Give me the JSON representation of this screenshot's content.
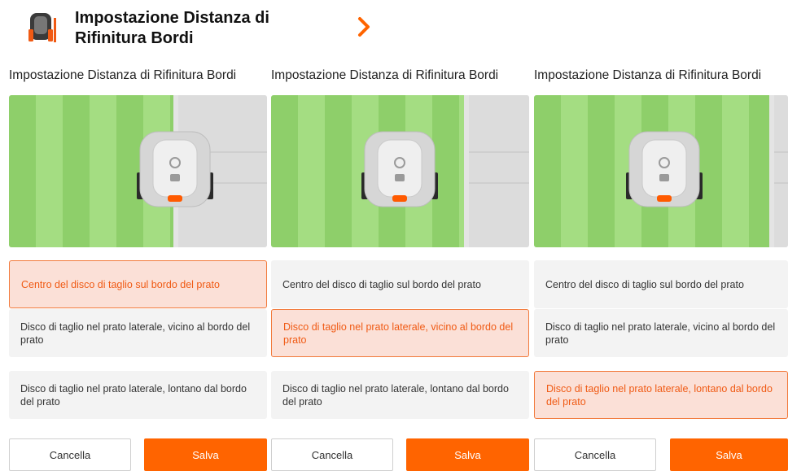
{
  "header": {
    "title": "Impostazione Distanza di Rifinitura Bordi",
    "icon": "mower-icon",
    "chevron_icon": "chevron-right-icon",
    "accent": "#ff6400"
  },
  "panels": [
    {
      "title": "Impostazione Distanza di Rifinitura Bordi",
      "selected_index": 0,
      "options": [
        "Centro del disco di taglio sul bordo del prato",
        "Disco di taglio nel prato laterale, vicino al bordo del prato",
        "Disco di taglio nel prato laterale, lontano dal bordo del prato"
      ],
      "cancel_label": "Cancella",
      "save_label": "Salva"
    },
    {
      "title": "Impostazione Distanza di Rifinitura Bordi",
      "selected_index": 1,
      "options": [
        "Centro del disco di taglio sul bordo del prato",
        "Disco di taglio nel prato laterale, vicino al bordo del prato",
        "Disco di taglio nel prato laterale, lontano dal bordo del prato"
      ],
      "cancel_label": "Cancella",
      "save_label": "Salva"
    },
    {
      "title": "Impostazione Distanza di Rifinitura Bordi",
      "selected_index": 2,
      "options": [
        "Centro del disco di taglio sul bordo del prato",
        "Disco di taglio nel prato laterale, vicino al bordo del prato",
        "Disco di taglio nel prato laterale, lontano dal bordo del prato"
      ],
      "cancel_label": "Cancella",
      "save_label": "Salva"
    }
  ]
}
